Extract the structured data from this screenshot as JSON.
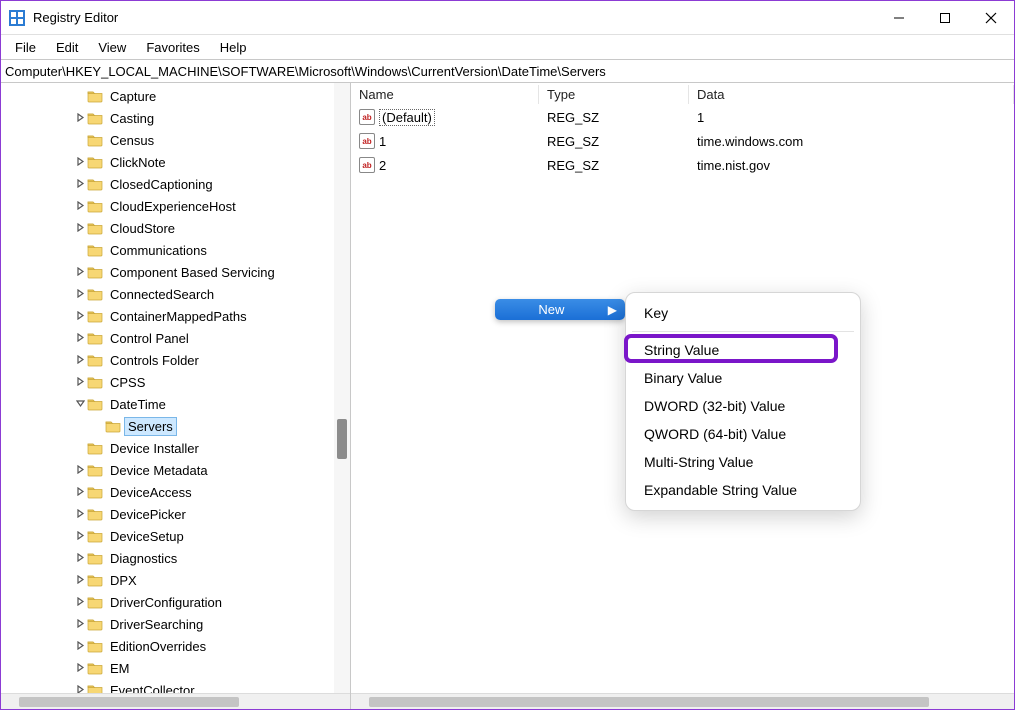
{
  "app": {
    "title": "Registry Editor"
  },
  "menubar": [
    "File",
    "Edit",
    "View",
    "Favorites",
    "Help"
  ],
  "address": "Computer\\HKEY_LOCAL_MACHINE\\SOFTWARE\\Microsoft\\Windows\\CurrentVersion\\DateTime\\Servers",
  "tree": [
    {
      "label": "Capture",
      "depth": 4,
      "twisty": "none"
    },
    {
      "label": "Casting",
      "depth": 4,
      "twisty": "closed"
    },
    {
      "label": "Census",
      "depth": 4,
      "twisty": "none"
    },
    {
      "label": "ClickNote",
      "depth": 4,
      "twisty": "closed"
    },
    {
      "label": "ClosedCaptioning",
      "depth": 4,
      "twisty": "closed"
    },
    {
      "label": "CloudExperienceHost",
      "depth": 4,
      "twisty": "closed"
    },
    {
      "label": "CloudStore",
      "depth": 4,
      "twisty": "closed"
    },
    {
      "label": "Communications",
      "depth": 4,
      "twisty": "none"
    },
    {
      "label": "Component Based Servicing",
      "depth": 4,
      "twisty": "closed"
    },
    {
      "label": "ConnectedSearch",
      "depth": 4,
      "twisty": "closed"
    },
    {
      "label": "ContainerMappedPaths",
      "depth": 4,
      "twisty": "closed"
    },
    {
      "label": "Control Panel",
      "depth": 4,
      "twisty": "closed"
    },
    {
      "label": "Controls Folder",
      "depth": 4,
      "twisty": "closed"
    },
    {
      "label": "CPSS",
      "depth": 4,
      "twisty": "closed"
    },
    {
      "label": "DateTime",
      "depth": 4,
      "twisty": "open"
    },
    {
      "label": "Servers",
      "depth": 5,
      "twisty": "none",
      "selected": true
    },
    {
      "label": "Device Installer",
      "depth": 4,
      "twisty": "none"
    },
    {
      "label": "Device Metadata",
      "depth": 4,
      "twisty": "closed"
    },
    {
      "label": "DeviceAccess",
      "depth": 4,
      "twisty": "closed"
    },
    {
      "label": "DevicePicker",
      "depth": 4,
      "twisty": "closed"
    },
    {
      "label": "DeviceSetup",
      "depth": 4,
      "twisty": "closed"
    },
    {
      "label": "Diagnostics",
      "depth": 4,
      "twisty": "closed"
    },
    {
      "label": "DPX",
      "depth": 4,
      "twisty": "closed"
    },
    {
      "label": "DriverConfiguration",
      "depth": 4,
      "twisty": "closed"
    },
    {
      "label": "DriverSearching",
      "depth": 4,
      "twisty": "closed"
    },
    {
      "label": "EditionOverrides",
      "depth": 4,
      "twisty": "closed"
    },
    {
      "label": "EM",
      "depth": 4,
      "twisty": "closed"
    },
    {
      "label": "EventCollector",
      "depth": 4,
      "twisty": "closed"
    }
  ],
  "list": {
    "columns": {
      "name": "Name",
      "type": "Type",
      "data": "Data"
    },
    "rows": [
      {
        "name": "(Default)",
        "type": "REG_SZ",
        "data": "1",
        "default": true
      },
      {
        "name": "1",
        "type": "REG_SZ",
        "data": "time.windows.com"
      },
      {
        "name": "2",
        "type": "REG_SZ",
        "data": "time.nist.gov"
      }
    ]
  },
  "context": {
    "parent_label": "New",
    "items": [
      {
        "label": "Key"
      },
      {
        "sep": true
      },
      {
        "label": "String Value",
        "highlighted": true
      },
      {
        "label": "Binary Value"
      },
      {
        "label": "DWORD (32-bit) Value"
      },
      {
        "label": "QWORD (64-bit) Value"
      },
      {
        "label": "Multi-String Value"
      },
      {
        "label": "Expandable String Value"
      }
    ]
  }
}
